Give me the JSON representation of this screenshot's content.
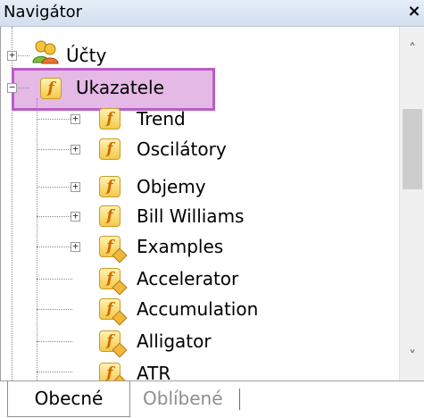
{
  "window": {
    "title": "Navigátor",
    "close_label": "×"
  },
  "tree": {
    "items": [
      {
        "label": "Účty",
        "icon": "accounts-icon",
        "expander": "+"
      },
      {
        "label": "Ukazatele",
        "icon": "function-folder-icon",
        "expander": "−",
        "selected": true
      },
      {
        "label": "Trend",
        "icon": "function-folder-icon",
        "expander": "+"
      },
      {
        "label": "Oscilátory",
        "icon": "function-folder-icon",
        "expander": "+"
      },
      {
        "label": "Objemy",
        "icon": "function-folder-icon",
        "expander": "+"
      },
      {
        "label": "Bill Williams",
        "icon": "function-folder-icon",
        "expander": "+"
      },
      {
        "label": "Examples",
        "icon": "custom-indicator-folder-icon",
        "expander": "+"
      },
      {
        "label": "Accelerator",
        "icon": "custom-indicator-icon"
      },
      {
        "label": "Accumulation",
        "icon": "custom-indicator-icon"
      },
      {
        "label": "Alligator",
        "icon": "custom-indicator-icon"
      },
      {
        "label": "ATR",
        "icon": "custom-indicator-icon"
      }
    ]
  },
  "scrollbar": {
    "up_arrow": "˄",
    "down_arrow": "˅"
  },
  "tabs": [
    {
      "label": "Obecné",
      "active": true
    },
    {
      "label": "Oblíbené",
      "active": false
    }
  ],
  "icon_glyph": "f",
  "colors": {
    "selection_highlight": "#c464c8",
    "title_bar": "#d9e4f2",
    "icon_orange": "#d06a00",
    "icon_fill": "#f4c94a"
  }
}
